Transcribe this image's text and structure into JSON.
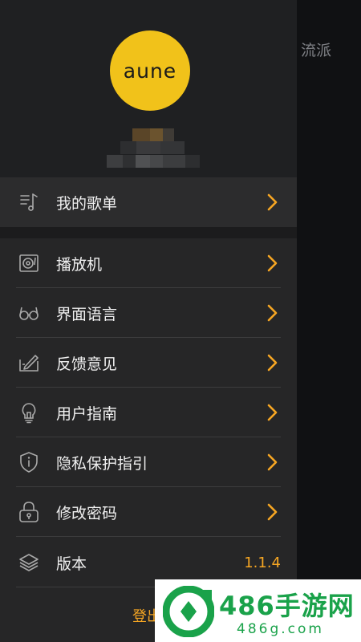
{
  "backdrop": {
    "tab_label": "流派"
  },
  "profile": {
    "logo_text": "aune"
  },
  "menu": {
    "playlist": "我的歌单",
    "items": [
      {
        "label": "播放机",
        "icon": "turntable-icon"
      },
      {
        "label": "界面语言",
        "icon": "glasses-icon"
      },
      {
        "label": "反馈意见",
        "icon": "edit-note-icon"
      },
      {
        "label": "用户指南",
        "icon": "lightbulb-icon"
      },
      {
        "label": "隐私保护指引",
        "icon": "shield-info-icon"
      },
      {
        "label": "修改密码",
        "icon": "lock-icon"
      }
    ],
    "version_label": "版本",
    "version_value": "1.1.4",
    "logout": "登出"
  },
  "watermark": {
    "title": "486手游网",
    "url": "486g.com"
  },
  "colors": {
    "accent": "#f6a623",
    "logo_bg": "#f1c21a",
    "drawer_bg": "#262627",
    "watermark_green": "#1aa24a"
  }
}
